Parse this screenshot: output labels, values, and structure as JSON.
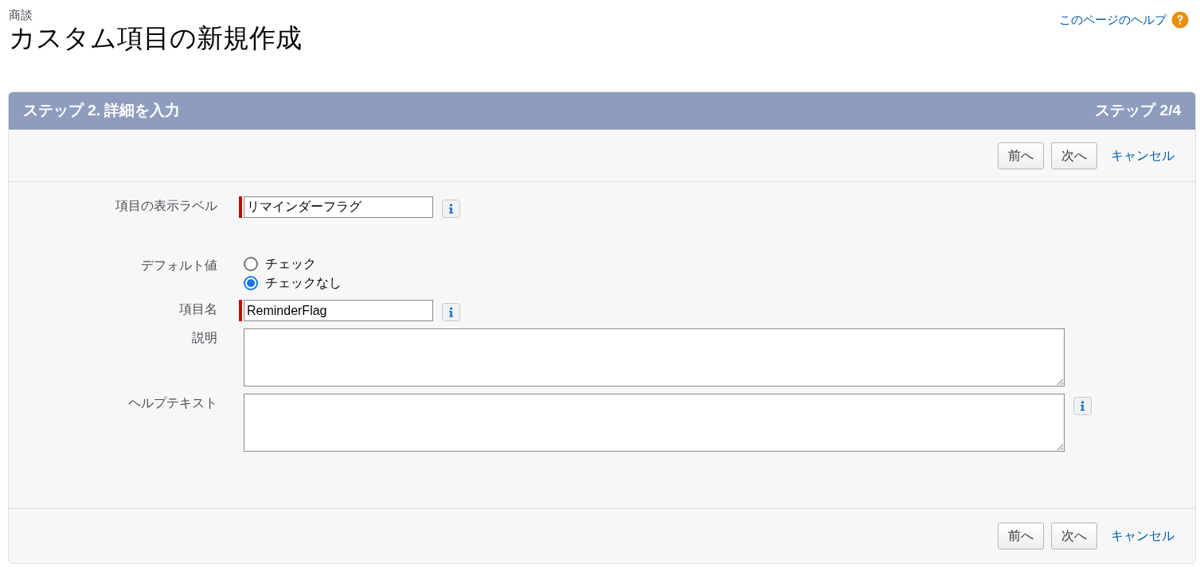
{
  "page": {
    "object_label": "商談",
    "title": "カスタム項目の新規作成",
    "help_link": "このページのヘルプ"
  },
  "step": {
    "title": "ステップ 2. 詳細を入力",
    "counter": "ステップ 2/4"
  },
  "top_buttons": [
    {
      "kind": "button",
      "label": "前へ"
    },
    {
      "kind": "button",
      "label": "次へ"
    },
    {
      "kind": "link",
      "label": "キャンセル"
    }
  ],
  "fields": [
    {
      "kind": "text",
      "label": "項目の表示ラベル",
      "value": "リマインダーフラグ",
      "required": true,
      "info": true
    },
    {
      "kind": "radio",
      "label": "デフォルト値",
      "options": [
        {
          "label": "チェック",
          "selected": false
        },
        {
          "label": "チェックなし",
          "selected": true
        }
      ]
    },
    {
      "kind": "text",
      "label": "項目名",
      "value": "ReminderFlag",
      "required": true,
      "info": true
    },
    {
      "kind": "textarea",
      "label": "説明",
      "required": false,
      "info": false
    },
    {
      "kind": "textarea",
      "label": "ヘルプテキスト",
      "required": false,
      "info": true
    }
  ],
  "bottom_buttons": [
    {
      "kind": "button",
      "label": "前へ"
    },
    {
      "kind": "button",
      "label": "次へ"
    },
    {
      "kind": "link",
      "label": "キャンセル"
    }
  ]
}
